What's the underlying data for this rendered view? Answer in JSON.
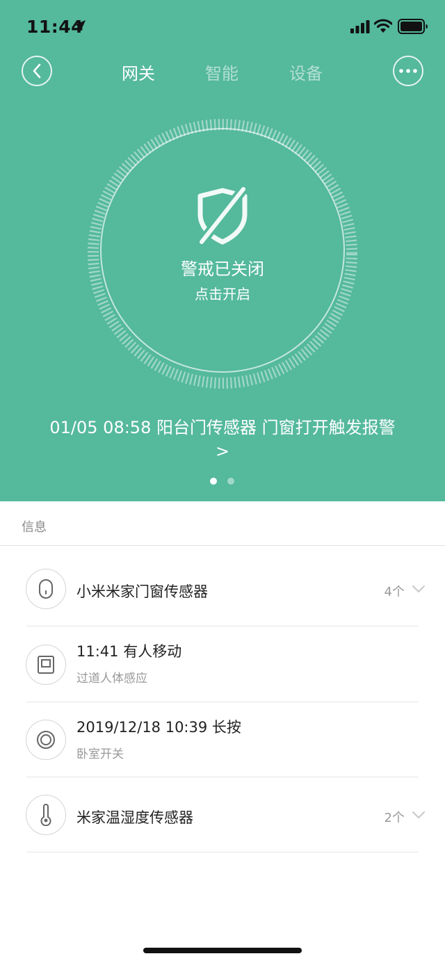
{
  "status_bar": {
    "time": "11:44"
  },
  "nav": {
    "tabs": [
      {
        "label": "网关",
        "active": true
      },
      {
        "label": "智能",
        "active": false
      },
      {
        "label": "设备",
        "active": false
      }
    ]
  },
  "alarm": {
    "status": "警戒已关闭",
    "hint": "点击开启"
  },
  "latest_event": {
    "text": "01/05 08:58 阳台门传感器 门窗打开触发报警",
    "arrow": ">"
  },
  "pager": {
    "total": 2,
    "current": 1
  },
  "info": {
    "section_label": "信息",
    "items": [
      {
        "title": "小米米家门窗传感器",
        "subtitle": "",
        "count": "4个",
        "icon": "door-sensor-icon"
      },
      {
        "title": " 11:41 有人移动",
        "subtitle": "过道人体感应",
        "count": "",
        "icon": "motion-sensor-icon"
      },
      {
        "title": "2019/12/18 10:39 长按",
        "subtitle": "卧室开关",
        "count": "",
        "icon": "wireless-switch-icon"
      },
      {
        "title": "米家温湿度传感器",
        "subtitle": "",
        "count": "2个",
        "icon": "thermometer-icon"
      }
    ]
  },
  "colors": {
    "hero_bg": "#55b99c",
    "text_primary": "#222222",
    "text_secondary": "#999999"
  }
}
